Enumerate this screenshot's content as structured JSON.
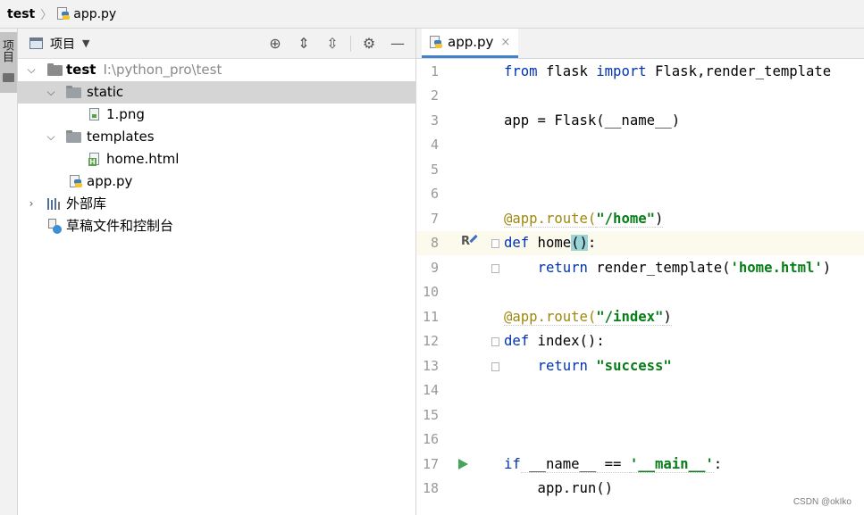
{
  "nav": {
    "project": "test",
    "file": "app.py"
  },
  "side_tab": {
    "label": "项目"
  },
  "project_panel": {
    "title": "项目",
    "tree": [
      {
        "label": "test",
        "path": "I:\\python_pro\\test"
      },
      {
        "label": "static"
      },
      {
        "label": "1.png"
      },
      {
        "label": "templates"
      },
      {
        "label": "home.html"
      },
      {
        "label": "app.py"
      },
      {
        "label": "外部库"
      },
      {
        "label": "草稿文件和控制台"
      }
    ]
  },
  "editor": {
    "tab": {
      "label": "app.py",
      "close": "×"
    },
    "line_numbers": [
      "1",
      "2",
      "3",
      "4",
      "5",
      "6",
      "7",
      "8",
      "9",
      "10",
      "11",
      "12",
      "13",
      "14",
      "15",
      "16",
      "17",
      "18"
    ],
    "code": {
      "l1_kw1": "from",
      "l1_mid": " flask ",
      "l1_kw2": "import",
      "l1_rest": " Flask,render_template",
      "l3": "app = Flask(__name__)",
      "l7_dec": "@app.route(",
      "l7_str": "\"/home\"",
      "l7_end": ")",
      "l8_kw": "def",
      "l8_name": " home",
      "l8_paren": "()",
      "l8_end": ":",
      "l9_indent": "    ",
      "l9_kw": "return",
      "l9_mid": " render_template(",
      "l9_str": "'home.html'",
      "l9_end": ")",
      "l11_dec": "@app.route(",
      "l11_str": "\"/index\"",
      "l11_end": ")",
      "l12_kw": "def",
      "l12_rest": " index():",
      "l13_indent": "    ",
      "l13_kw": "return",
      "l13_sp": " ",
      "l13_str": "\"success\"",
      "l17_kw": "if",
      "l17_mid": " __name__ == ",
      "l17_str": "'__main__'",
      "l17_end": ":",
      "l18": "    app.run()"
    }
  },
  "watermark": "CSDN @okIko",
  "colors": {
    "keyword": "#0033b3",
    "string": "#067d17",
    "decorator": "#9e880d",
    "selection": "#d5d5d5",
    "tab_accent": "#4083c9"
  }
}
